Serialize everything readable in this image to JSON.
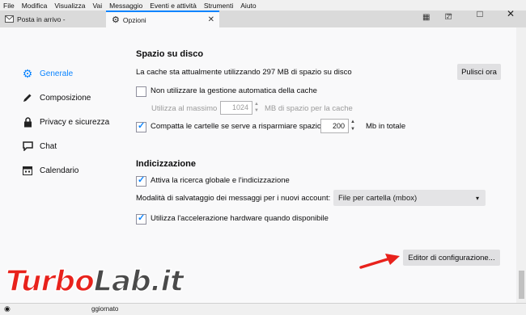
{
  "menubar": [
    "File",
    "Modifica",
    "Visualizza",
    "Vai",
    "Messaggio",
    "Eventi e attività",
    "Strumenti",
    "Aiuto"
  ],
  "tabs": [
    {
      "label": "Posta in arrivo -",
      "icon": "mail-icon"
    },
    {
      "label": "Opzioni",
      "icon": "gear-icon"
    }
  ],
  "window_controls": {
    "minimize": "–",
    "maximize": "□",
    "close": "✕"
  },
  "sidebar": {
    "items": [
      {
        "label": "Generale",
        "icon": "gear-icon",
        "selected": true
      },
      {
        "label": "Composizione",
        "icon": "pencil-icon"
      },
      {
        "label": "Privacy e sicurezza",
        "icon": "lock-icon"
      },
      {
        "label": "Chat",
        "icon": "chat-icon"
      },
      {
        "label": "Calendario",
        "icon": "calendar-icon"
      }
    ]
  },
  "disk": {
    "title": "Spazio su disco",
    "cache_text": "La cache sta attualmente utilizzando 297 MB di spazio su disco",
    "clear_button": "Pulisci ora",
    "no_auto_cache": "Non utilizzare la gestione automatica della cache",
    "max_label": "Utilizza al massimo",
    "max_value": "1024",
    "max_suffix": "MB di spazio per la cache",
    "compact_label": "Compatta le cartelle se serve a risparmiare spazio",
    "compact_value": "200",
    "compact_suffix": "Mb in totale"
  },
  "indexing": {
    "title": "Indicizzazione",
    "global_search": "Attiva la ricerca globale e l'indicizzazione",
    "store_label": "Modalità di salvataggio dei messaggi per i nuovi account:",
    "store_value": "File per cartella (mbox)",
    "hw_accel": "Utilizza l'accelerazione hardware quando disponibile"
  },
  "config_button": "Editor di configurazione...",
  "status": {
    "text": "ggiornato"
  },
  "watermark": {
    "part1": "Turbo",
    "part2": "Lab.it"
  },
  "colors": {
    "accent": "#0a84ff",
    "arrow": "#e8221c"
  }
}
